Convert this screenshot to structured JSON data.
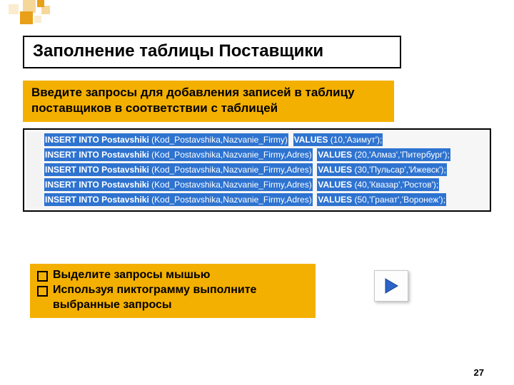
{
  "colors": {
    "accent": "#f4b000",
    "selection": "#2e73d0"
  },
  "title": "Заполнение таблицы Поставщики",
  "intro": "Введите запросы для добавления записей в таблицу поставщиков в соответствии с таблицей",
  "sql": {
    "table": "Postavshiki",
    "lines": [
      {
        "cols": "Kod_Postavshika,Nazvanie_Firmy",
        "values": "(10,'Азимут');"
      },
      {
        "cols": "Kod_Postavshika,Nazvanie_Firmy,Adres",
        "values": "(20,'Алмаз','Питербург');"
      },
      {
        "cols": "Kod_Postavshika,Nazvanie_Firmy,Adres",
        "values": "(30,'Пульсар','Ижевск');"
      },
      {
        "cols": "Kod_Postavshika,Nazvanie_Firmy,Adres",
        "values": "(40,'Квазар','Ростов');"
      },
      {
        "cols": "Kod_Postavshika,Nazvanie_Firmy,Adres",
        "values": "(50,'Гранат','Воронеж');"
      }
    ],
    "kw_insert": "INSERT INTO",
    "kw_values": "VALUES"
  },
  "steps": [
    "Выделите запросы мышью",
    "Используя пиктограмму выполните выбранные запросы"
  ],
  "icons": {
    "play": "play-icon"
  },
  "page_number": "27"
}
